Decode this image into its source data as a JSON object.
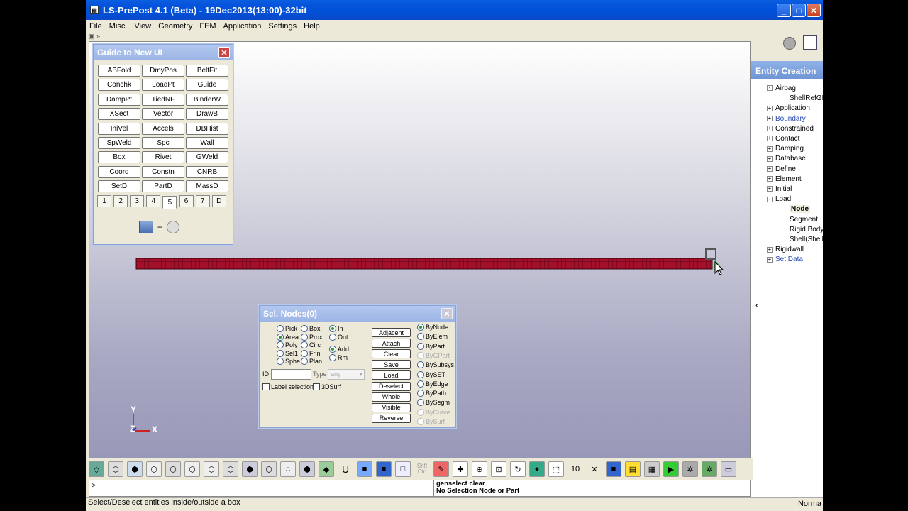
{
  "window": {
    "title": "LS-PrePost 4.1 (Beta) - 19Dec2013(13:00)-32bit",
    "buttons": {
      "minimize": "_",
      "maximize": "□",
      "close": "✕"
    }
  },
  "menu": [
    "File",
    "Misc.",
    "View",
    "Geometry",
    "FEM",
    "Application",
    "Settings",
    "Help"
  ],
  "top_toolbar": {
    "collapse": "▣ »"
  },
  "guide_panel": {
    "title": "Guide to New UI",
    "buttons": [
      [
        "ABFold",
        "DmyPos",
        "BeltFit"
      ],
      [
        "Conchk",
        "LoadPt",
        "Guide"
      ],
      [
        "DampPt",
        "TiedNF",
        "BinderW"
      ],
      [
        "XSect",
        "Vector",
        "DrawB"
      ],
      [
        "IniVel",
        "Accels",
        "DBHist"
      ],
      [
        "SpWeld",
        "Spc",
        "Wall"
      ],
      [
        "Box",
        "Rivet",
        "GWeld"
      ],
      [
        "Coord",
        "Constn",
        "CNRB"
      ],
      [
        "SetD",
        "PartD",
        "MassD"
      ]
    ],
    "tabs": [
      "1",
      "2",
      "3",
      "4",
      "5",
      "6",
      "7",
      "D"
    ],
    "active_tab": "5",
    "separator": "--"
  },
  "sel_nodes": {
    "title": "Sel. Nodes(0)",
    "col1": [
      {
        "label": "Pick",
        "on": false
      },
      {
        "label": "Area",
        "on": true
      },
      {
        "label": "Poly",
        "on": false
      },
      {
        "label": "Sel1",
        "on": false
      },
      {
        "label": "Sphe",
        "on": false
      }
    ],
    "col2": [
      {
        "label": "Box",
        "on": false
      },
      {
        "label": "Prox",
        "on": false
      },
      {
        "label": "Circ",
        "on": false
      },
      {
        "label": "Frin",
        "on": false
      },
      {
        "label": "Plan",
        "on": false
      }
    ],
    "col3a": [
      {
        "label": "In",
        "on": true
      },
      {
        "label": "Out",
        "on": false
      }
    ],
    "col3b": [
      {
        "label": "Add",
        "on": true
      },
      {
        "label": "Rm",
        "on": false
      }
    ],
    "actions": [
      "Adjacent",
      "Attach",
      "Clear",
      "Save",
      "Load",
      "Deselect",
      "Whole",
      "Visible",
      "Reverse"
    ],
    "by": [
      {
        "label": "ByNode",
        "on": true,
        "disabled": false
      },
      {
        "label": "ByElem",
        "on": false,
        "disabled": false
      },
      {
        "label": "ByPart",
        "on": false,
        "disabled": false
      },
      {
        "label": "ByGPart",
        "on": false,
        "disabled": true
      },
      {
        "label": "BySubsys",
        "on": false,
        "disabled": false
      },
      {
        "label": "BySET",
        "on": false,
        "disabled": false
      },
      {
        "label": "ByEdge",
        "on": false,
        "disabled": false
      },
      {
        "label": "ByPath",
        "on": false,
        "disabled": false
      },
      {
        "label": "BySegm",
        "on": false,
        "disabled": false
      },
      {
        "label": "ByCurve",
        "on": false,
        "disabled": true
      },
      {
        "label": "BySurf",
        "on": false,
        "disabled": true
      }
    ],
    "id_label": "ID",
    "type_label": "Type",
    "type_value": "any",
    "label_selection": "Label selection",
    "surf3d": "3DSurf"
  },
  "triad": {
    "y": "Y",
    "z": "Z",
    "x": "X"
  },
  "entity_creation": {
    "title": "Entity Creation",
    "items": [
      {
        "label": "Airbag",
        "box": "-",
        "level": 0,
        "selected": false,
        "blue": false
      },
      {
        "label": "ShellRefGM",
        "box": "",
        "level": 1,
        "selected": false,
        "blue": false
      },
      {
        "label": "Application",
        "box": "+",
        "level": 0,
        "selected": false,
        "blue": false
      },
      {
        "label": "Boundary",
        "box": "+",
        "level": 0,
        "selected": false,
        "blue": true
      },
      {
        "label": "Constrained",
        "box": "+",
        "level": 0,
        "selected": false,
        "blue": false
      },
      {
        "label": "Contact",
        "box": "+",
        "level": 0,
        "selected": false,
        "blue": false
      },
      {
        "label": "Damping",
        "box": "+",
        "level": 0,
        "selected": false,
        "blue": false
      },
      {
        "label": "Database",
        "box": "+",
        "level": 0,
        "selected": false,
        "blue": false
      },
      {
        "label": "Define",
        "box": "+",
        "level": 0,
        "selected": false,
        "blue": false
      },
      {
        "label": "Element",
        "box": "+",
        "level": 0,
        "selected": false,
        "blue": false
      },
      {
        "label": "Initial",
        "box": "+",
        "level": 0,
        "selected": false,
        "blue": false
      },
      {
        "label": "Load",
        "box": "-",
        "level": 0,
        "selected": false,
        "blue": false
      },
      {
        "label": "Node",
        "box": "",
        "level": 1,
        "selected": true,
        "blue": false
      },
      {
        "label": "Segment",
        "box": "",
        "level": 1,
        "selected": false,
        "blue": false
      },
      {
        "label": "Rigid Body",
        "box": "",
        "level": 1,
        "selected": false,
        "blue": false
      },
      {
        "label": "Shell(Shell",
        "box": "",
        "level": 1,
        "selected": false,
        "blue": false
      },
      {
        "label": "Rigidwall",
        "box": "+",
        "level": 0,
        "selected": false,
        "blue": false
      },
      {
        "label": "Set Data",
        "box": "+",
        "level": 0,
        "selected": false,
        "blue": true
      }
    ],
    "collapse_arrow": "‹"
  },
  "bottom_toolbar": {
    "shift_ctrl": "Shft Ctrl",
    "u_label": "U",
    "ten_label": "10"
  },
  "command": {
    "prompt": ">"
  },
  "messages": [
    "genselect clear",
    "No Selection Node or Part"
  ],
  "status": {
    "text": "Select/Deselect entities inside/outside a box",
    "mode": "Norma"
  }
}
